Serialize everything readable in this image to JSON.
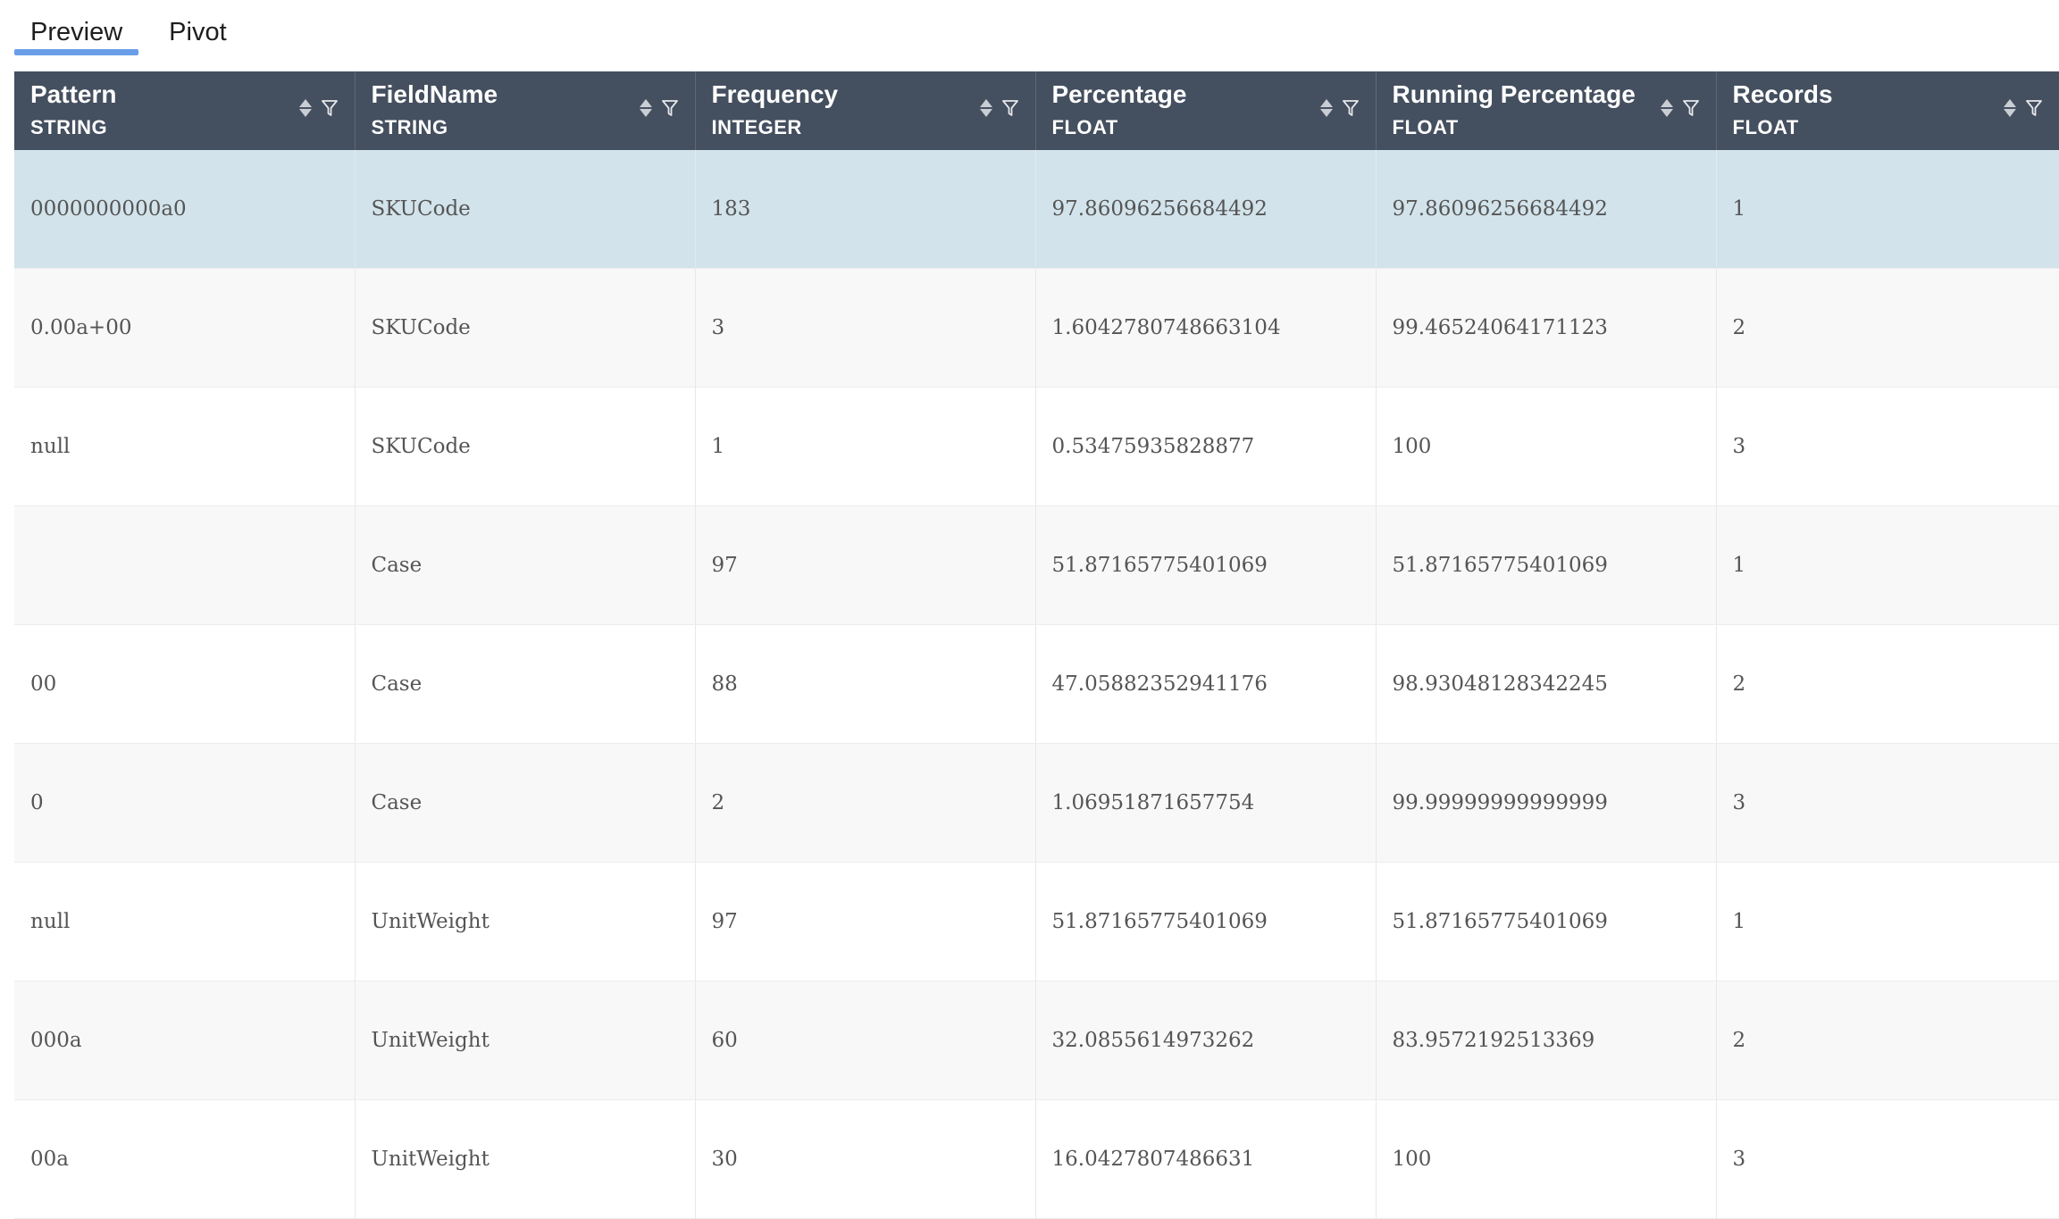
{
  "tabs": [
    {
      "label": "Preview",
      "active": true
    },
    {
      "label": "Pivot",
      "active": false
    }
  ],
  "colors": {
    "header_bg": "#444f5f",
    "tab_indicator": "#6a9ee8",
    "selected_row": "#d2e3eb"
  },
  "table": {
    "columns": [
      {
        "name": "Pattern",
        "type": "STRING"
      },
      {
        "name": "FieldName",
        "type": "STRING"
      },
      {
        "name": "Frequency",
        "type": "INTEGER"
      },
      {
        "name": "Percentage",
        "type": "FLOAT"
      },
      {
        "name": "Running Percentage ...",
        "type": "FLOAT"
      },
      {
        "name": "Records",
        "type": "FLOAT"
      }
    ],
    "selected_row_index": 0,
    "rows": [
      [
        "0000000000a0",
        "SKUCode",
        "183",
        "97.86096256684492",
        "97.86096256684492",
        "1"
      ],
      [
        "0.00a+00",
        "SKUCode",
        "3",
        "1.6042780748663104",
        "99.46524064171123",
        "2"
      ],
      [
        "null",
        "SKUCode",
        "1",
        "0.53475935828877",
        "100",
        "3"
      ],
      [
        "",
        "Case",
        "97",
        "51.87165775401069",
        "51.87165775401069",
        "1"
      ],
      [
        "00",
        "Case",
        "88",
        "47.05882352941176",
        "98.93048128342245",
        "2"
      ],
      [
        "0",
        "Case",
        "2",
        "1.06951871657754",
        "99.99999999999999",
        "3"
      ],
      [
        "null",
        "UnitWeight",
        "97",
        "51.87165775401069",
        "51.87165775401069",
        "1"
      ],
      [
        "000a",
        "UnitWeight",
        "60",
        "32.0855614973262",
        "83.9572192513369",
        "2"
      ],
      [
        "00a",
        "UnitWeight",
        "30",
        "16.0427807486631",
        "100",
        "3"
      ]
    ]
  }
}
